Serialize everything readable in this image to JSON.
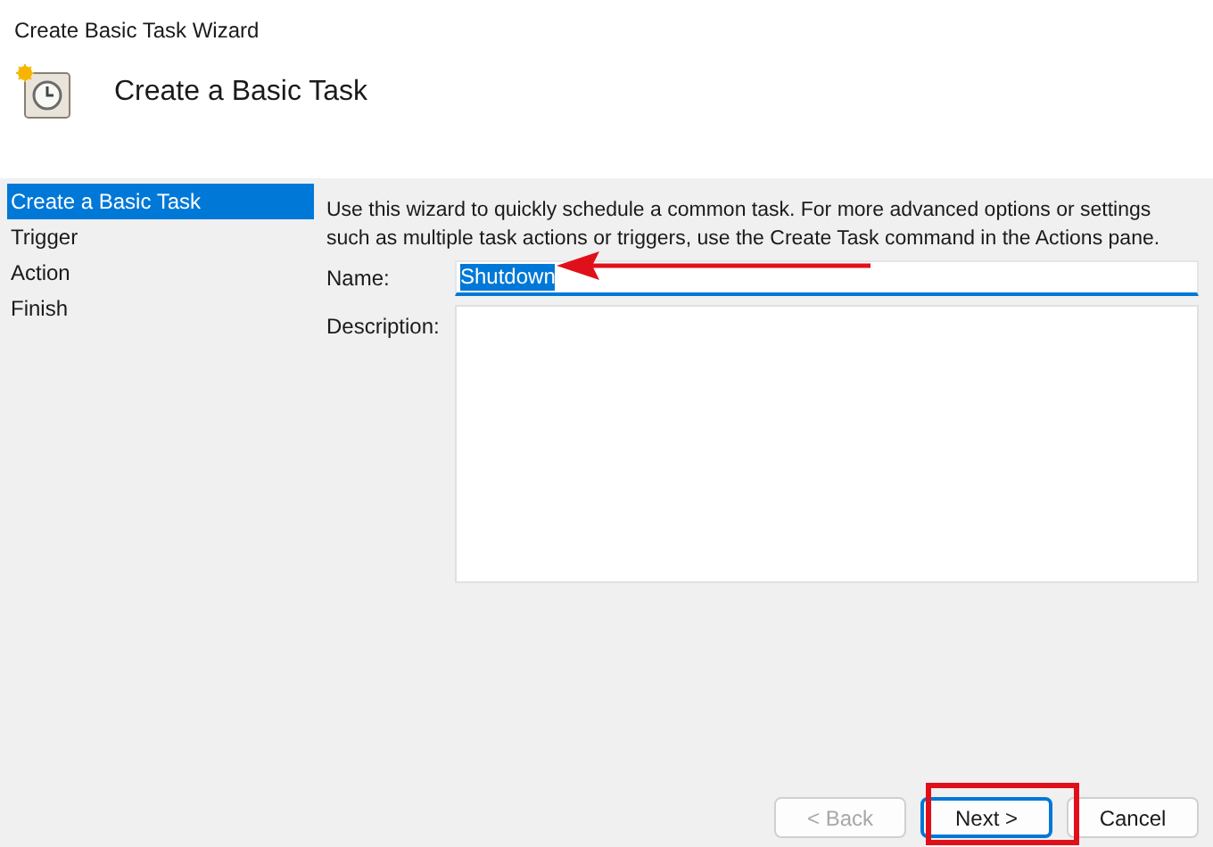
{
  "window": {
    "title": "Create Basic Task Wizard"
  },
  "header": {
    "title": "Create a Basic Task"
  },
  "sidebar": {
    "items": [
      {
        "label": "Create a Basic Task",
        "selected": true
      },
      {
        "label": "Trigger",
        "selected": false
      },
      {
        "label": "Action",
        "selected": false
      },
      {
        "label": "Finish",
        "selected": false
      }
    ]
  },
  "intro": "Use this wizard to quickly schedule a common task.  For more advanced options or settings such as multiple task actions or triggers, use the Create Task command in the Actions pane.",
  "name_field": {
    "label": "Name:",
    "value": "Shutdown",
    "text_selected": true
  },
  "description_field": {
    "label": "Description:"
  },
  "buttons": [
    {
      "label": "< Back",
      "disabled": true,
      "focused": false
    },
    {
      "label": "Next >",
      "disabled": false,
      "focused": true
    },
    {
      "label": "Cancel",
      "disabled": false,
      "focused": false
    }
  ]
}
